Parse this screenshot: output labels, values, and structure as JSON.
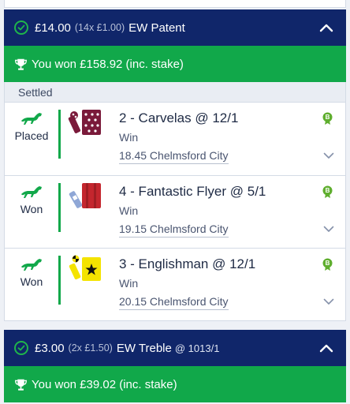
{
  "bets": [
    {
      "stake": "£14.00",
      "multiplier": "(14x £1.00)",
      "bet_type": "EW Patent",
      "odds": "",
      "won_text": "You won £158.92 (inc. stake)",
      "section_label": "Settled",
      "selections": [
        {
          "result": "Placed",
          "name": "2 - Carvelas @ 12/1",
          "market": "Win",
          "race": "18.45 Chelmsford City",
          "silks": "maroon-white-spots"
        },
        {
          "result": "Won",
          "name": "4 - Fantastic Flyer @ 5/1",
          "market": "Win",
          "race": "19.15 Chelmsford City",
          "silks": "red-blue-sleeves"
        },
        {
          "result": "Won",
          "name": "3 - Englishman @ 12/1",
          "market": "Win",
          "race": "20.15 Chelmsford City",
          "silks": "yellow-black-star"
        }
      ]
    },
    {
      "stake": "£3.00",
      "multiplier": "(2x £1.50)",
      "bet_type": "EW Treble",
      "odds": "@ 1013/1",
      "won_text": "You won £39.02 (inc. stake)"
    }
  ],
  "colors": {
    "header_navy": "#10266a",
    "win_green": "#11a84a",
    "settled_bg": "#e9edf3"
  },
  "icons": [
    "check-circle-icon",
    "chevron-up-icon",
    "trophy-icon",
    "horse-icon",
    "boost-badge-icon",
    "chevron-down-icon"
  ]
}
